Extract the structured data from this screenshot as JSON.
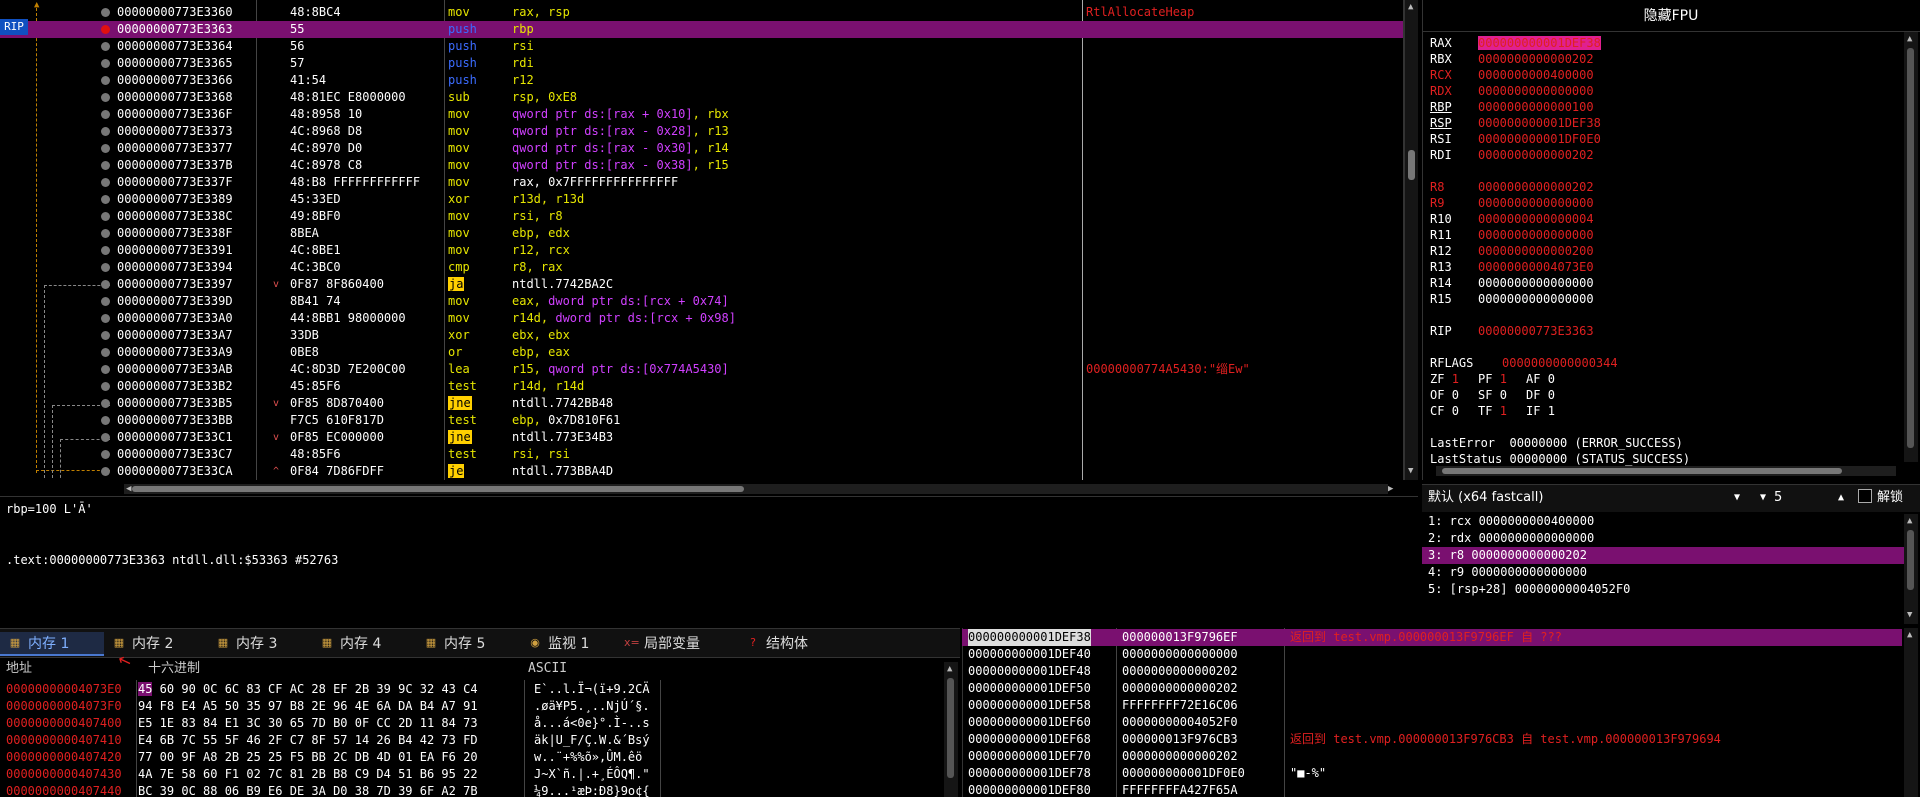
{
  "disasm": {
    "rip_label": "RIP",
    "selected_index": 1,
    "rows": [
      {
        "addr": "00000000773E3360",
        "bytes": "48:8BC4",
        "mnem": "mov",
        "mclass": "mov",
        "ops": [
          [
            "reg",
            "rax, rsp"
          ]
        ],
        "comment": "RtlAllocateHeap",
        "arrow": ""
      },
      {
        "addr": "00000000773E3363",
        "bytes": "55",
        "mnem": "push",
        "mclass": "push",
        "ops": [
          [
            "reg",
            "rbp"
          ]
        ],
        "comment": "",
        "arrow": ""
      },
      {
        "addr": "00000000773E3364",
        "bytes": "56",
        "mnem": "push",
        "mclass": "push",
        "ops": [
          [
            "reg",
            "rsi"
          ]
        ],
        "comment": "",
        "arrow": ""
      },
      {
        "addr": "00000000773E3365",
        "bytes": "57",
        "mnem": "push",
        "mclass": "push",
        "ops": [
          [
            "reg",
            "rdi"
          ]
        ],
        "comment": "",
        "arrow": ""
      },
      {
        "addr": "00000000773E3366",
        "bytes": "41:54",
        "mnem": "push",
        "mclass": "push",
        "ops": [
          [
            "reg",
            "r12"
          ]
        ],
        "comment": "",
        "arrow": ""
      },
      {
        "addr": "00000000773E3368",
        "bytes": "48:81EC E8000000",
        "mnem": "sub",
        "mclass": "sub",
        "ops": [
          [
            "reg",
            "rsp, 0xE8"
          ]
        ],
        "comment": "",
        "arrow": ""
      },
      {
        "addr": "00000000773E336F",
        "bytes": "48:8958 10",
        "mnem": "mov",
        "mclass": "mov",
        "ops": [
          [
            "mem",
            "qword ptr ds:[rax + 0x10]"
          ],
          [
            "reg",
            ", rbx"
          ]
        ],
        "comment": "",
        "arrow": ""
      },
      {
        "addr": "00000000773E3373",
        "bytes": "4C:8968 D8",
        "mnem": "mov",
        "mclass": "mov",
        "ops": [
          [
            "mem",
            "qword ptr ds:[rax - 0x28]"
          ],
          [
            "reg",
            ", r13"
          ]
        ],
        "comment": "",
        "arrow": ""
      },
      {
        "addr": "00000000773E3377",
        "bytes": "4C:8970 D0",
        "mnem": "mov",
        "mclass": "mov",
        "ops": [
          [
            "mem",
            "qword ptr ds:[rax - 0x30]"
          ],
          [
            "reg",
            ", r14"
          ]
        ],
        "comment": "",
        "arrow": ""
      },
      {
        "addr": "00000000773E337B",
        "bytes": "4C:8978 C8",
        "mnem": "mov",
        "mclass": "mov",
        "ops": [
          [
            "mem",
            "qword ptr ds:[rax - 0x38]"
          ],
          [
            "reg",
            ", r15"
          ]
        ],
        "comment": "",
        "arrow": ""
      },
      {
        "addr": "00000000773E337F",
        "bytes": "48:B8 FFFFFFFFFFFF",
        "mnem": "mov",
        "mclass": "mov",
        "ops": [
          [
            "plain",
            "rax, 0x7FFFFFFFFFFFFFFF"
          ]
        ],
        "comment": "",
        "arrow": ""
      },
      {
        "addr": "00000000773E3389",
        "bytes": "45:33ED",
        "mnem": "xor",
        "mclass": "xor",
        "ops": [
          [
            "reg",
            "r13d, r13d"
          ]
        ],
        "comment": "",
        "arrow": ""
      },
      {
        "addr": "00000000773E338C",
        "bytes": "49:8BF0",
        "mnem": "mov",
        "mclass": "mov",
        "ops": [
          [
            "reg",
            "rsi, r8"
          ]
        ],
        "comment": "",
        "arrow": ""
      },
      {
        "addr": "00000000773E338F",
        "bytes": "8BEA",
        "mnem": "mov",
        "mclass": "mov",
        "ops": [
          [
            "reg",
            "ebp, edx"
          ]
        ],
        "comment": "",
        "arrow": ""
      },
      {
        "addr": "00000000773E3391",
        "bytes": "4C:8BE1",
        "mnem": "mov",
        "mclass": "mov",
        "ops": [
          [
            "reg",
            "r12, rcx"
          ]
        ],
        "comment": "",
        "arrow": ""
      },
      {
        "addr": "00000000773E3394",
        "bytes": "4C:3BC0",
        "mnem": "cmp",
        "mclass": "cmp",
        "ops": [
          [
            "reg",
            "r8, rax"
          ]
        ],
        "comment": "",
        "arrow": ""
      },
      {
        "addr": "00000000773E3397",
        "bytes": "0F87 8F860400",
        "mnem": "ja",
        "mclass": "jcc",
        "ops": [
          [
            "plain",
            "ntdll.7742BA2C"
          ]
        ],
        "comment": "",
        "arrow": "v"
      },
      {
        "addr": "00000000773E339D",
        "bytes": "8B41 74",
        "mnem": "mov",
        "mclass": "mov",
        "ops": [
          [
            "reg",
            "eax, "
          ],
          [
            "mem",
            "dword ptr ds:[rcx + 0x74]"
          ]
        ],
        "comment": "",
        "arrow": ""
      },
      {
        "addr": "00000000773E33A0",
        "bytes": "44:8BB1 98000000",
        "mnem": "mov",
        "mclass": "mov",
        "ops": [
          [
            "reg",
            "r14d, "
          ],
          [
            "mem",
            "dword ptr ds:[rcx + 0x98]"
          ]
        ],
        "comment": "",
        "arrow": ""
      },
      {
        "addr": "00000000773E33A7",
        "bytes": "33DB",
        "mnem": "xor",
        "mclass": "xor",
        "ops": [
          [
            "reg",
            "ebx, ebx"
          ]
        ],
        "comment": "",
        "arrow": ""
      },
      {
        "addr": "00000000773E33A9",
        "bytes": "0BE8",
        "mnem": "or",
        "mclass": "or",
        "ops": [
          [
            "reg",
            "ebp, eax"
          ]
        ],
        "comment": "",
        "arrow": ""
      },
      {
        "addr": "00000000773E33AB",
        "bytes": "4C:8D3D 7E200C00",
        "mnem": "lea",
        "mclass": "lea",
        "ops": [
          [
            "reg",
            "r15, "
          ],
          [
            "mem",
            "qword ptr ds:[0x774A5430]"
          ]
        ],
        "comment": "00000000774A5430:\"缁Ew\"",
        "arrow": ""
      },
      {
        "addr": "00000000773E33B2",
        "bytes": "45:85F6",
        "mnem": "test",
        "mclass": "test",
        "ops": [
          [
            "reg",
            "r14d, r14d"
          ]
        ],
        "comment": "",
        "arrow": ""
      },
      {
        "addr": "00000000773E33B5",
        "bytes": "0F85 8D870400",
        "mnem": "jne",
        "mclass": "jcc",
        "ops": [
          [
            "plain",
            "ntdll.7742BB48"
          ]
        ],
        "comment": "",
        "arrow": "v"
      },
      {
        "addr": "00000000773E33BB",
        "bytes": "F7C5 610F817D",
        "mnem": "test",
        "mclass": "test",
        "ops": [
          [
            "reg",
            "ebp, "
          ],
          [
            "plain",
            "0x7D810F61"
          ]
        ],
        "comment": "",
        "arrow": ""
      },
      {
        "addr": "00000000773E33C1",
        "bytes": "0F85 EC000000",
        "mnem": "jne",
        "mclass": "jcc",
        "ops": [
          [
            "plain",
            "ntdll.773E34B3"
          ]
        ],
        "comment": "",
        "arrow": "v"
      },
      {
        "addr": "00000000773E33C7",
        "bytes": "48:85F6",
        "mnem": "test",
        "mclass": "test",
        "ops": [
          [
            "reg",
            "rsi, rsi"
          ]
        ],
        "comment": "",
        "arrow": ""
      },
      {
        "addr": "00000000773E33CA",
        "bytes": "0F84 7D86FDFF",
        "mnem": "je",
        "mclass": "jcc",
        "ops": [
          [
            "plain",
            "ntdll.773BBA4D"
          ]
        ],
        "comment": "",
        "arrow": "^"
      }
    ]
  },
  "info": {
    "line1": "rbp=100 L'Ā'",
    "line2": ".text:00000000773E3363 ntdll.dll:$53363 #52763"
  },
  "registers": {
    "header": "隐藏FPU",
    "gprs": [
      {
        "name": "RAX",
        "value": "000000000001DEF38",
        "name_red": false,
        "val_style": "hl"
      },
      {
        "name": "RBX",
        "value": "0000000000000202",
        "name_red": false,
        "val_style": "r"
      },
      {
        "name": "RCX",
        "value": "0000000000400000",
        "name_red": true,
        "val_style": "r"
      },
      {
        "name": "RDX",
        "value": "0000000000000000",
        "name_red": true,
        "val_style": "r"
      },
      {
        "name": "RBP",
        "value": "0000000000000100",
        "name_red": false,
        "val_style": "r"
      },
      {
        "name": "RSP",
        "value": "000000000001DEF38",
        "name_red": false,
        "val_style": "r"
      },
      {
        "name": "RSI",
        "value": "000000000001DF0E0",
        "name_red": false,
        "val_style": "r"
      },
      {
        "name": "RDI",
        "value": "0000000000000202",
        "name_red": false,
        "val_style": "r"
      }
    ],
    "ext": [
      {
        "name": "R8",
        "value": "0000000000000202",
        "name_red": true,
        "val_style": "r"
      },
      {
        "name": "R9",
        "value": "0000000000000000",
        "name_red": true,
        "val_style": "r"
      },
      {
        "name": "R10",
        "value": "0000000000000004",
        "name_red": false,
        "val_style": "r"
      },
      {
        "name": "R11",
        "value": "0000000000000000",
        "name_red": false,
        "val_style": "r"
      },
      {
        "name": "R12",
        "value": "0000000000000200",
        "name_red": false,
        "val_style": "r"
      },
      {
        "name": "R13",
        "value": "00000000004073E0",
        "name_red": false,
        "val_style": "r"
      },
      {
        "name": "R14",
        "value": "0000000000000000",
        "name_red": false,
        "val_style": "w"
      },
      {
        "name": "R15",
        "value": "0000000000000000",
        "name_red": false,
        "val_style": "w"
      }
    ],
    "rip": {
      "name": "RIP",
      "value": "00000000773E3363"
    },
    "rflags": {
      "name": "RFLAGS",
      "value": "0000000000000344"
    },
    "flags_rows": [
      [
        {
          "n": "ZF",
          "v": "1",
          "red": true
        },
        {
          "n": "PF",
          "v": "1",
          "red": true
        },
        {
          "n": "AF",
          "v": "0",
          "red": false
        }
      ],
      [
        {
          "n": "OF",
          "v": "0",
          "red": false
        },
        {
          "n": "SF",
          "v": "0",
          "red": false
        },
        {
          "n": "DF",
          "v": "0",
          "red": false
        }
      ],
      [
        {
          "n": "CF",
          "v": "0",
          "red": false
        },
        {
          "n": "TF",
          "v": "1",
          "red": true
        },
        {
          "n": "IF",
          "v": "1",
          "red": false
        }
      ]
    ],
    "last_error": "LastError  00000000 (ERROR_SUCCESS)",
    "last_status": "LastStatus 00000000 (STATUS_SUCCESS)"
  },
  "callconv": {
    "mode": "默认 (x64 fastcall)",
    "count": "5",
    "unlock_label": "解锁",
    "args": [
      "1: rcx 0000000000400000",
      "2: rdx 0000000000000000",
      "3: r8 0000000000000202",
      "4: r9 0000000000000000",
      "5: [rsp+28] 00000000004052F0"
    ],
    "selected_index": 2
  },
  "tabs": [
    {
      "label": "内存 1",
      "icon": "▦",
      "active": true
    },
    {
      "label": "内存 2",
      "icon": "▦",
      "active": false
    },
    {
      "label": "内存 3",
      "icon": "▦",
      "active": false
    },
    {
      "label": "内存 4",
      "icon": "▦",
      "active": false
    },
    {
      "label": "内存 5",
      "icon": "▦",
      "active": false
    },
    {
      "label": "监视 1",
      "icon": "◉",
      "active": false
    },
    {
      "label": "局部变量",
      "icon": "x=",
      "active": false
    },
    {
      "label": "结构体",
      "icon": "?",
      "active": false
    }
  ],
  "dump": {
    "col_addr": "地址",
    "col_hex": "十六进制",
    "col_ascii": "ASCII",
    "rows": [
      {
        "addr": "00000000004073E0",
        "hex": "45 60 90 0C 6C 83 CF AC 28 EF 2B 39 9C 32 43 C4",
        "ascii": "E`..l.Ï¬(ï+9.2CÄ"
      },
      {
        "addr": "00000000004073F0",
        "hex": "94 F8 E4 A5 50 35 97 B8 2E 96 4E 6A DA B4 A7 91",
        "ascii": ".øä¥P5.¸..NjÚ´§."
      },
      {
        "addr": "0000000000407400",
        "hex": "E5 1E 83 84 E1 3C 30 65 7D B0 0F CC 2D 11 84 73",
        "ascii": "å...á<0e}°.Ì-..s"
      },
      {
        "addr": "0000000000407410",
        "hex": "E4 6B 7C 55 5F 46 2F C7 8F 57 14 26 B4 42 73 FD",
        "ascii": "äk|U_F/Ç.W.&´Bsý"
      },
      {
        "addr": "0000000000407420",
        "hex": "77 00 9F A8 2B 25 25 F5 BB 2C DB 4D 01 EA F6 20",
        "ascii": "w..¨+%%õ»,ÛM.êö "
      },
      {
        "addr": "0000000000407430",
        "hex": "4A 7E 58 60 F1 02 7C 81 2B B8 C9 D4 51 B6 95 22",
        "ascii": "J~X`ñ.|.+¸ÉÔQ¶.\""
      },
      {
        "addr": "0000000000407440",
        "hex": "BC 39 0C 88 06 B9 E6 DE 3A D0 38 7D 39 6F A2 7B",
        "ascii": "¼9...¹æÞ:Ð8}9o¢{"
      }
    ]
  },
  "stack": {
    "selected_index": 0,
    "rows": [
      {
        "addr": "000000000001DEF38",
        "val": "000000013F9796EF",
        "cmt": "返回到 test.vmp.000000013F9796EF 自 ???"
      },
      {
        "addr": "000000000001DEF40",
        "val": "0000000000000000",
        "cmt": ""
      },
      {
        "addr": "000000000001DEF48",
        "val": "0000000000000202",
        "cmt": ""
      },
      {
        "addr": "000000000001DEF50",
        "val": "0000000000000202",
        "cmt": ""
      },
      {
        "addr": "000000000001DEF58",
        "val": "FFFFFFFF72E16C06",
        "cmt": ""
      },
      {
        "addr": "000000000001DEF60",
        "val": "00000000004052F0",
        "cmt": ""
      },
      {
        "addr": "000000000001DEF68",
        "val": "000000013F976CB3",
        "cmt": "返回到 test.vmp.000000013F976CB3 自 test.vmp.000000013F979694"
      },
      {
        "addr": "000000000001DEF70",
        "val": "0000000000000202",
        "cmt": ""
      },
      {
        "addr": "000000000001DEF78",
        "val": "000000000001DF0E0",
        "cmt": "\"■-%\""
      },
      {
        "addr": "000000000001DEF80",
        "val": "FFFFFFFFA427F65A",
        "cmt": ""
      }
    ]
  }
}
